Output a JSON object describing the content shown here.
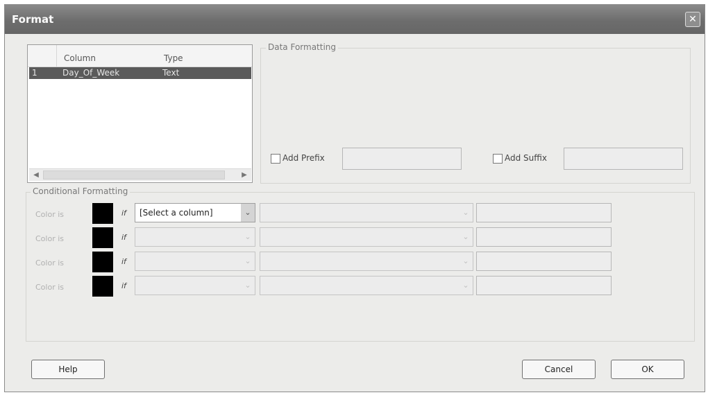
{
  "window": {
    "title": "Format",
    "close_glyph": "✕"
  },
  "column_list": {
    "headers": [
      "Column",
      "Type"
    ],
    "rows": [
      {
        "index": "1",
        "column": "Day_Of_Week",
        "type": "Text",
        "selected": true
      }
    ],
    "scroll_left": "◀",
    "scroll_right": "▶"
  },
  "data_formatting": {
    "legend": "Data Formatting",
    "add_prefix_label": "Add Prefix",
    "add_prefix_checked": false,
    "prefix_value": "",
    "add_suffix_label": "Add Suffix",
    "add_suffix_checked": false,
    "suffix_value": ""
  },
  "conditional_formatting": {
    "legend": "Conditional Formatting",
    "rows": [
      {
        "label": "Color is",
        "if": "if",
        "column_select": "[Select a column]",
        "operator": "",
        "value": "",
        "swatch_color": "#000000"
      },
      {
        "label": "Color is",
        "if": "if",
        "column_select": "",
        "operator": "",
        "value": "",
        "swatch_color": "#000000"
      },
      {
        "label": "Color is",
        "if": "if",
        "column_select": "",
        "operator": "",
        "value": "",
        "swatch_color": "#000000"
      },
      {
        "label": "Color is",
        "if": "if",
        "column_select": "",
        "operator": "",
        "value": "",
        "swatch_color": "#000000"
      }
    ],
    "dropdown_glyph": "⌄"
  },
  "buttons": {
    "help": "Help",
    "cancel": "Cancel",
    "ok": "OK"
  },
  "colors": {
    "title_bar": "#6d6d6d",
    "dialog_bg": "#ececea",
    "selected_row": "#5a5a5a"
  }
}
